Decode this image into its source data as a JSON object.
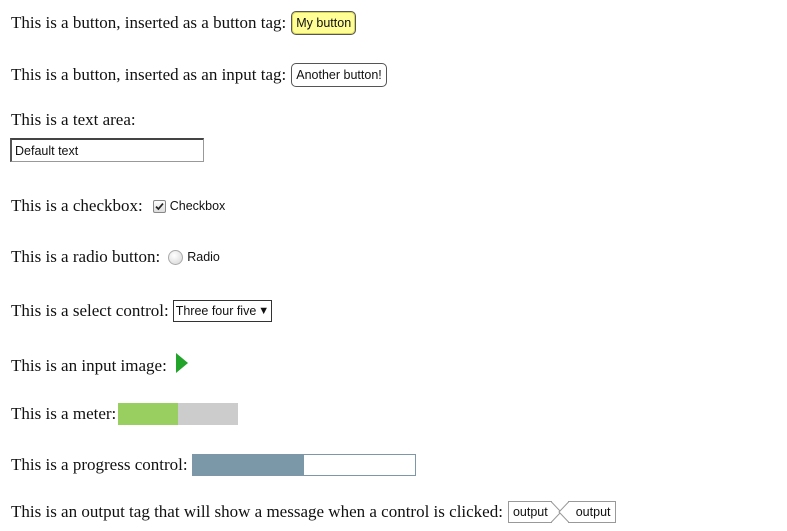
{
  "rows": {
    "button_tag": {
      "label": "This is a button, inserted as a button tag:",
      "button": "My button"
    },
    "input_tag": {
      "label": "This is a button, inserted as an input tag:",
      "button": "Another button!"
    },
    "textarea": {
      "label": "This is a text area:",
      "value": "Default text"
    },
    "checkbox": {
      "label": "This is a checkbox:",
      "text": "Checkbox",
      "checked": true
    },
    "radio": {
      "label": "This is a radio button:",
      "text": "Radio",
      "checked": false
    },
    "select": {
      "label": "This is a select control:",
      "value": "Three four five"
    },
    "input_image": {
      "label": "This is an input image:",
      "icon": "play-triangle-icon",
      "color": "#22a32a"
    },
    "meter": {
      "label": "This is a meter:",
      "value": 0.5,
      "fill_color": "#98cf60",
      "track_color": "#cccccc"
    },
    "progress": {
      "label": "This is a progress control:",
      "value": 0.5,
      "fill_color": "#7b98a8"
    },
    "output": {
      "label": "This is an output tag that will show a message when a control is clicked:",
      "output1": "output",
      "output2": "output"
    }
  }
}
